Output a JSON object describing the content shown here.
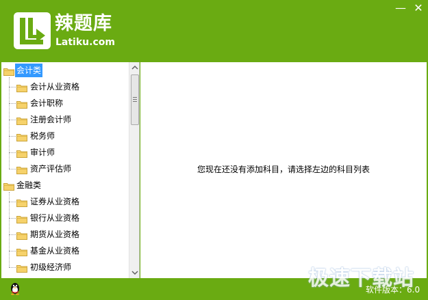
{
  "app": {
    "brand_cn": "辣题库",
    "brand_en": "Latiku.com",
    "min_glyph": "—",
    "close_glyph": "✕"
  },
  "tree": {
    "categories": [
      {
        "label": "会计类",
        "selected": true,
        "children": [
          "会计从业资格",
          "会计职称",
          "注册会计师",
          "税务师",
          "审计师",
          "资产评估师"
        ]
      },
      {
        "label": "金融类",
        "selected": false,
        "children": [
          "证券从业资格",
          "银行从业资格",
          "期货从业资格",
          "基金从业资格",
          "初级经济师"
        ]
      }
    ]
  },
  "main": {
    "empty_message": "您现在还没有添加科目，请选择左边的科目列表"
  },
  "status": {
    "version_text": "软件版本：6.0",
    "watermark": "极速下载站"
  },
  "colors": {
    "brand_green": "#6aab12",
    "selection_blue": "#3399ff"
  },
  "icons": {
    "logo": "latiku-logo-icon",
    "folder": "folder-icon",
    "qq": "qq-penguin-icon"
  }
}
